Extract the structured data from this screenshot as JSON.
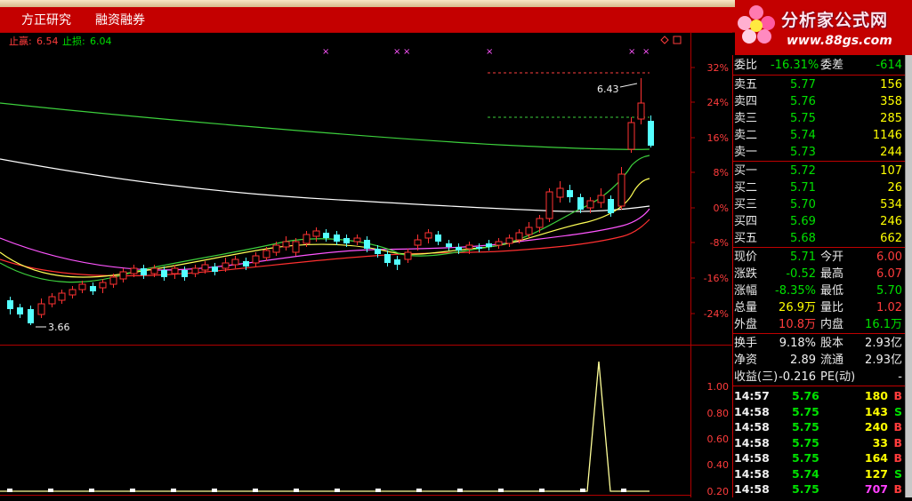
{
  "menu": {
    "items": [
      "方正研究",
      "融资融券"
    ]
  },
  "logo": {
    "title": "分析家公式网",
    "url": "www.88gs.com"
  },
  "chart": {
    "take_profit_label": "止赢:",
    "take_profit_value": "6.54",
    "stop_loss_label": "止损:",
    "stop_loss_value": "6.04",
    "y_ticks": [
      "32%",
      "24%",
      "16%",
      "8%",
      "0%",
      "-8%",
      "-16%",
      "-24%"
    ],
    "high_annotation": "6.43",
    "low_annotation": "3.66",
    "sub_ticks": [
      "1.00",
      "0.80",
      "0.60",
      "0.40",
      "0.20"
    ],
    "colors": {
      "up": "#ff3232",
      "down": "#54ffff",
      "ma_green": "#3dd13d",
      "ma_white": "#ffffff",
      "ma_yellow": "#ffff55",
      "ma_magenta": "#ff55ff",
      "ma_red": "#ff3030"
    }
  },
  "quote": {
    "weibi_label": "委比",
    "weibi_value": "-16.31%",
    "weicha_label": "委差",
    "weicha_value": "-614",
    "asks": [
      {
        "label": "卖五",
        "price": "5.77",
        "volume": "156"
      },
      {
        "label": "卖四",
        "price": "5.76",
        "volume": "358"
      },
      {
        "label": "卖三",
        "price": "5.75",
        "volume": "285"
      },
      {
        "label": "卖二",
        "price": "5.74",
        "volume": "1146"
      },
      {
        "label": "卖一",
        "price": "5.73",
        "volume": "244"
      }
    ],
    "bids": [
      {
        "label": "买一",
        "price": "5.72",
        "volume": "107"
      },
      {
        "label": "买二",
        "price": "5.71",
        "volume": "26"
      },
      {
        "label": "买三",
        "price": "5.70",
        "volume": "534"
      },
      {
        "label": "买四",
        "price": "5.69",
        "volume": "246"
      },
      {
        "label": "买五",
        "price": "5.68",
        "volume": "662"
      }
    ],
    "stats": [
      {
        "l1": "现价",
        "v1": "5.71",
        "l2": "今开",
        "v2": "6.00"
      },
      {
        "l1": "涨跌",
        "v1": "-0.52",
        "l2": "最高",
        "v2": "6.07"
      },
      {
        "l1": "涨幅",
        "v1": "-8.35%",
        "l2": "最低",
        "v2": "5.70"
      },
      {
        "l1": "总量",
        "v1": "26.9万",
        "l2": "量比",
        "v2": "1.02"
      },
      {
        "l1": "外盘",
        "v1": "10.8万",
        "l2": "内盘",
        "v2": "16.1万"
      }
    ],
    "fundamentals": [
      {
        "l1": "换手",
        "v1": "9.18%",
        "l2": "股本",
        "v2": "2.93亿"
      },
      {
        "l1": "净资",
        "v1": "2.89",
        "l2": "流通",
        "v2": "2.93亿"
      },
      {
        "l1": "收益(三)",
        "v1": "-0.216",
        "l2": "PE(动)",
        "v2": "-"
      }
    ],
    "ticks": [
      {
        "time": "14:57",
        "price": "5.76",
        "volume": "180",
        "side": "B"
      },
      {
        "time": "14:58",
        "price": "5.75",
        "volume": "143",
        "side": "S"
      },
      {
        "time": "14:58",
        "price": "5.75",
        "volume": "240",
        "side": "B"
      },
      {
        "time": "14:58",
        "price": "5.75",
        "volume": "33",
        "side": "B"
      },
      {
        "time": "14:58",
        "price": "5.75",
        "volume": "164",
        "side": "B"
      },
      {
        "time": "14:58",
        "price": "5.74",
        "volume": "127",
        "side": "S"
      },
      {
        "time": "14:58",
        "price": "5.75",
        "volume": "707",
        "side": "B"
      }
    ]
  }
}
